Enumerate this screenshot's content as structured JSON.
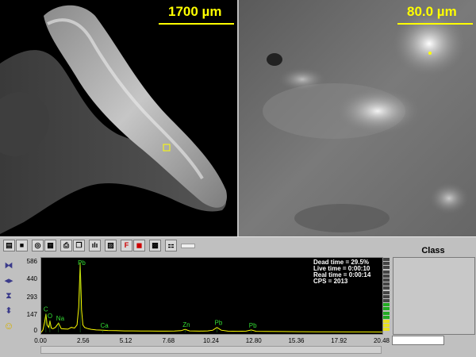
{
  "left_image": {
    "scale_label": "1700 µm"
  },
  "right_image": {
    "scale_label": "80.0 µm"
  },
  "toolbar": {
    "buttons": [
      {
        "name": "open-icon",
        "glyph": "▤"
      },
      {
        "name": "save-icon",
        "glyph": "■"
      },
      {
        "name": "camera-icon",
        "glyph": "◎"
      },
      {
        "name": "preview-icon",
        "glyph": "▦"
      },
      {
        "name": "print-icon",
        "glyph": "⎙"
      },
      {
        "name": "copy-icon",
        "glyph": "❐"
      },
      {
        "name": "bars-icon",
        "glyph": "ılı"
      },
      {
        "name": "pattern-icon",
        "glyph": "▨"
      },
      {
        "name": "peak-label-icon",
        "glyph": "F"
      },
      {
        "name": "stop-icon",
        "glyph": "◼"
      },
      {
        "name": "grid-icon",
        "glyph": "▩"
      },
      {
        "name": "network-icon",
        "glyph": "⚏"
      }
    ]
  },
  "side_tools": [
    {
      "name": "zoom-horizontal-in-icon",
      "glyph": "⧓"
    },
    {
      "name": "zoom-horizontal-out-icon",
      "glyph": "◂▸"
    },
    {
      "name": "zoom-vertical-in-icon",
      "glyph": "⧗"
    },
    {
      "name": "zoom-vertical-out-icon",
      "glyph": "⬍"
    },
    {
      "name": "smiley-icon",
      "glyph": "☺"
    }
  ],
  "status": {
    "dead_time": "Dead time = 29.5%",
    "live_time": "Live time = 0:00:10",
    "real_time": "Real time = 0:00:14",
    "cps": "CPS = 2013"
  },
  "class_panel": {
    "header": "Class"
  },
  "chart_data": {
    "type": "line",
    "x_ticks": [
      "0.00",
      "2.56",
      "5.12",
      "7.68",
      "10.24",
      "12.80",
      "15.36",
      "17.92",
      "20.48"
    ],
    "y_ticks": [
      "586",
      "440",
      "293",
      "147",
      "0"
    ],
    "xlim": [
      0,
      20.48
    ],
    "ylim": [
      0,
      586
    ],
    "peaks": [
      {
        "label": "C",
        "x": 0.28,
        "y": 150
      },
      {
        "label": "O",
        "x": 0.52,
        "y": 95
      },
      {
        "label": "Na",
        "x": 1.04,
        "y": 75
      },
      {
        "label": "Pb",
        "x": 2.34,
        "y": 560
      },
      {
        "label": "Ca",
        "x": 3.69,
        "y": 18
      },
      {
        "label": "Zn",
        "x": 8.63,
        "y": 25
      },
      {
        "label": "Pb",
        "x": 10.55,
        "y": 40
      },
      {
        "label": "Pb",
        "x": 12.61,
        "y": 20
      }
    ],
    "series": [
      {
        "x": [
          0.0,
          0.1,
          0.2,
          0.28,
          0.35,
          0.45,
          0.52,
          0.6,
          0.7,
          0.85,
          1.04,
          1.2,
          1.4,
          1.6,
          1.8,
          2.0,
          2.15,
          2.25,
          2.34,
          2.42,
          2.5,
          2.6,
          2.8,
          3.0,
          3.3,
          3.69,
          4.0,
          4.5,
          5.0,
          5.5,
          6.0,
          6.5,
          7.0,
          7.5,
          8.0,
          8.4,
          8.63,
          8.9,
          9.5,
          10.0,
          10.3,
          10.55,
          10.8,
          11.2,
          11.8,
          12.3,
          12.61,
          12.9,
          13.5,
          14.5,
          15.5,
          16.5,
          17.5,
          18.5,
          19.5,
          20.48
        ],
        "y": [
          0,
          20,
          80,
          150,
          60,
          40,
          95,
          35,
          30,
          40,
          75,
          30,
          28,
          26,
          40,
          35,
          60,
          200,
          560,
          180,
          60,
          40,
          30,
          25,
          20,
          18,
          15,
          14,
          12,
          12,
          11,
          11,
          10,
          10,
          11,
          14,
          25,
          12,
          10,
          12,
          18,
          40,
          18,
          10,
          9,
          10,
          20,
          9,
          8,
          7,
          6,
          5,
          5,
          4,
          4,
          3
        ]
      }
    ]
  }
}
